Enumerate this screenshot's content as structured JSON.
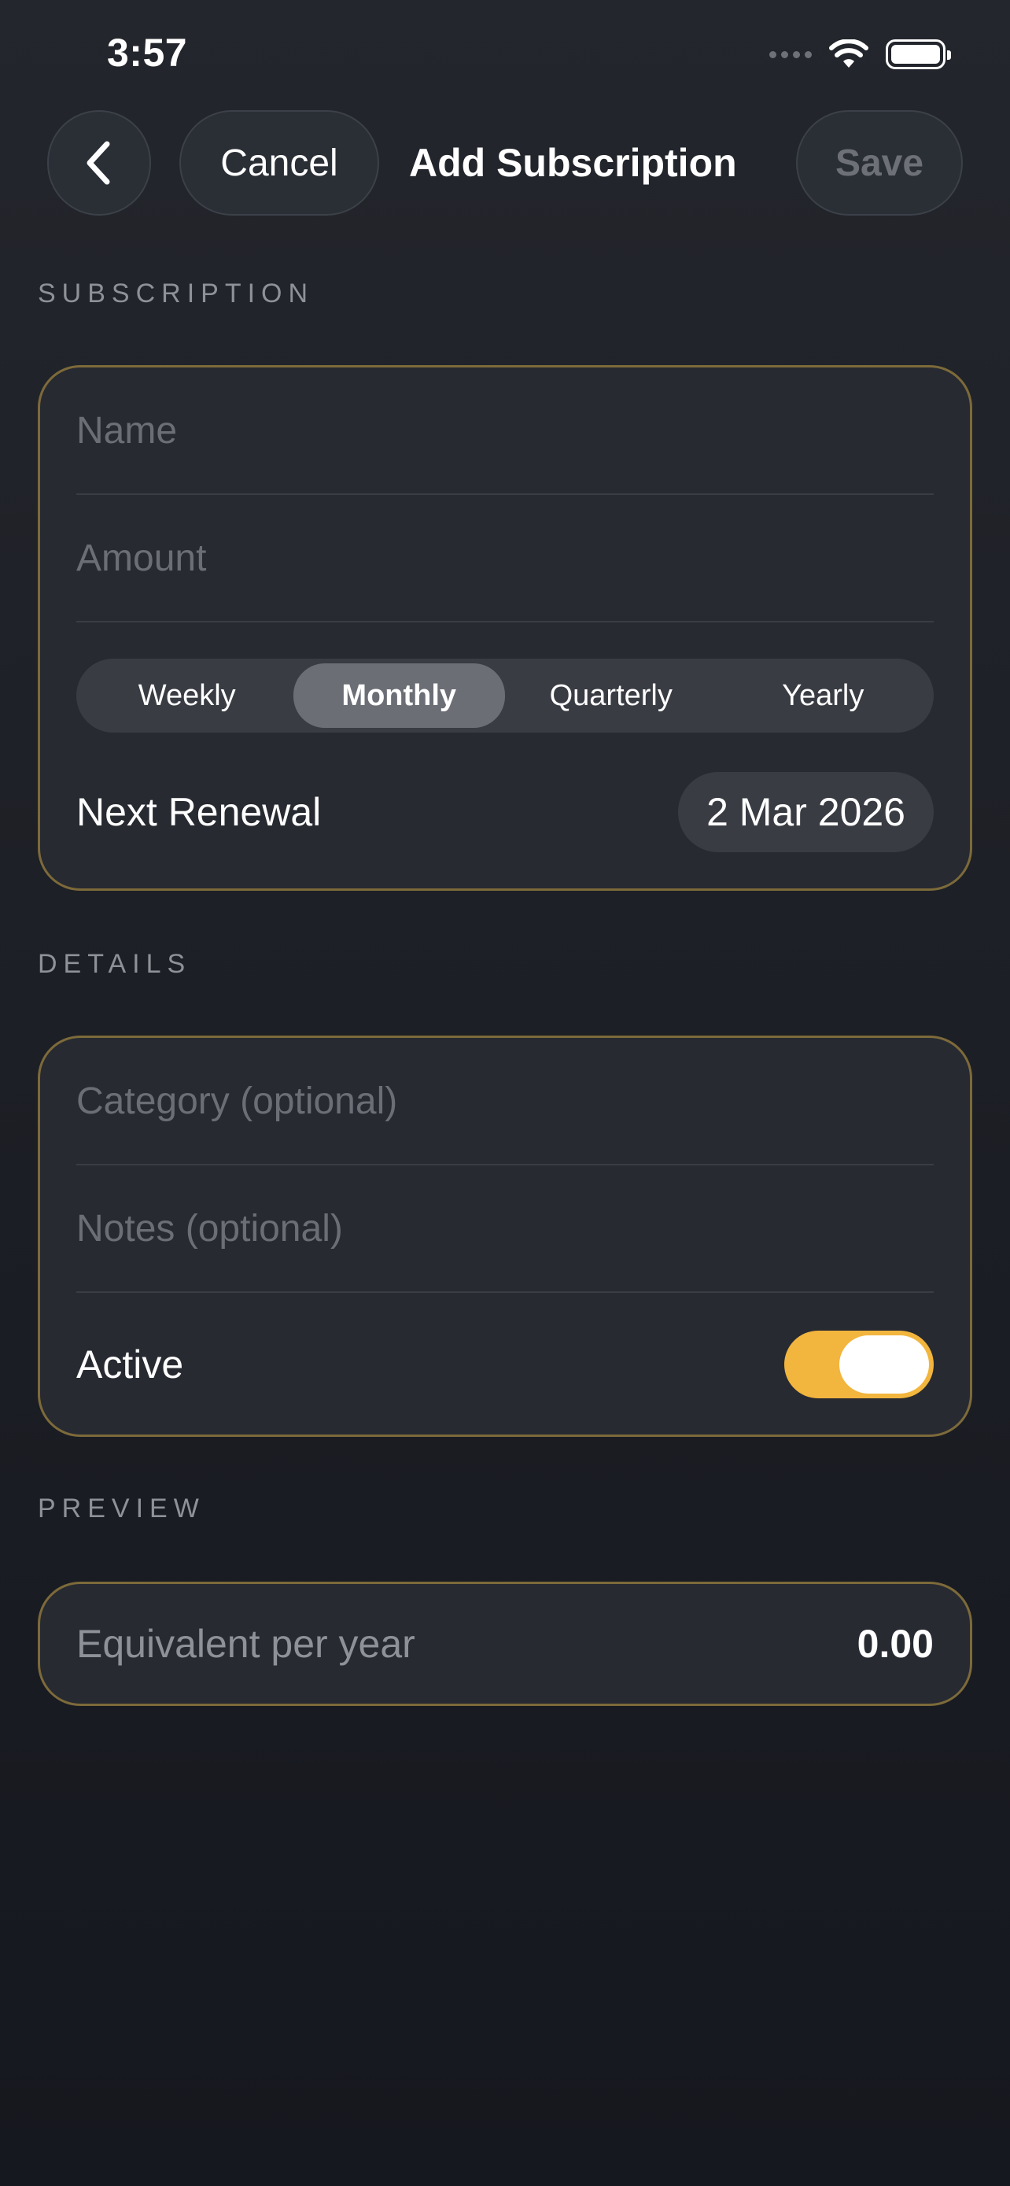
{
  "status_bar": {
    "time": "3:57"
  },
  "nav": {
    "cancel_label": "Cancel",
    "title": "Add Subscription",
    "save_label": "Save"
  },
  "subscription_section": {
    "label": "SUBSCRIPTION",
    "name_placeholder": "Name",
    "name_value": "",
    "amount_placeholder": "Amount",
    "amount_value": "",
    "frequency_options": [
      "Weekly",
      "Monthly",
      "Quarterly",
      "Yearly"
    ],
    "selected_frequency": "Monthly",
    "next_renewal_label": "Next Renewal",
    "next_renewal_date": "2 Mar 2026"
  },
  "details_section": {
    "label": "DETAILS",
    "category_placeholder": "Category (optional)",
    "category_value": "",
    "notes_placeholder": "Notes (optional)",
    "notes_value": "",
    "active_label": "Active",
    "active": true
  },
  "preview_section": {
    "label": "PREVIEW",
    "equivalent_label": "Equivalent per year",
    "equivalent_value": "0.00"
  },
  "colors": {
    "accent": "#f2b53d",
    "card_border": "#7d6a3a",
    "background": "#1b1e24"
  },
  "icons": {
    "back": "chevron-left-icon",
    "wifi": "wifi-icon",
    "battery": "battery-icon",
    "signal": "signal-icon"
  }
}
